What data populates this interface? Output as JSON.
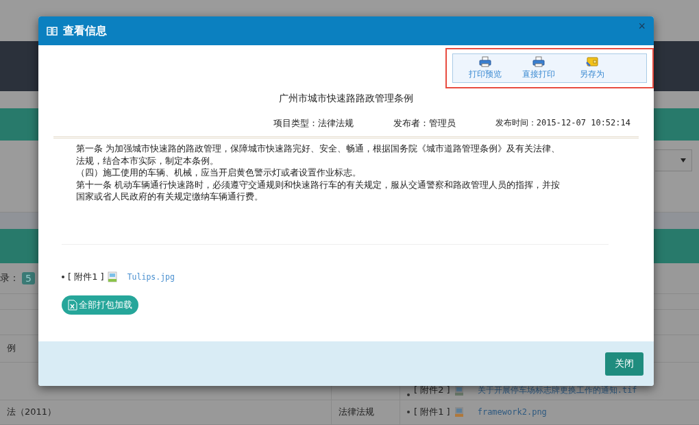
{
  "background_page": {
    "record_label": "录：",
    "record_count": "5",
    "row_title": "例",
    "attachment_row": {
      "tag": "[ 附件2 ]",
      "file": "关于开展停车场标志牌更换工作的通知.tif"
    },
    "last_row": {
      "title": "法（2011）",
      "type": "法律法规",
      "tag": "[ 附件1 ]",
      "file": "framework2.png"
    }
  },
  "dialog": {
    "title": "查看信息",
    "close_glyph": "×",
    "toolbar": {
      "highlighted": true,
      "items": [
        {
          "kind": "print",
          "label": "打印预览"
        },
        {
          "kind": "print",
          "label": "直接打印"
        },
        {
          "kind": "save",
          "label": "另存为"
        }
      ]
    },
    "document": {
      "title": "广州市城市快速路路政管理条例",
      "meta": [
        {
          "label": "项目类型：",
          "value": "法律法规"
        },
        {
          "label": "发布者：",
          "value": "管理员"
        },
        {
          "label": "发布时间：",
          "value": "2015-12-07 10:52:14"
        }
      ],
      "paragraphs": [
        "第一条 为加强城市快速路的路政管理，保障城市快速路完好、安全、畅通，根据国务院《城市道路管理条例》及有关法律、法规，结合本市实际，制定本条例。",
        "（四）施工使用的车辆、机械，应当开启黄色警示灯或者设置作业标志。",
        "第十一条 机动车辆通行快速路时，必须遵守交通规则和快速路行车的有关规定，服从交通警察和路政管理人员的指挥，并按国家或省人民政府的有关规定缴纳车辆通行费。"
      ]
    },
    "attachments": [
      {
        "kind": "image",
        "tag": "[ 附件1 ]",
        "file": "Tulips.jpg"
      }
    ],
    "download_all_button": "全部打包加载",
    "footer_button": "关闭"
  }
}
